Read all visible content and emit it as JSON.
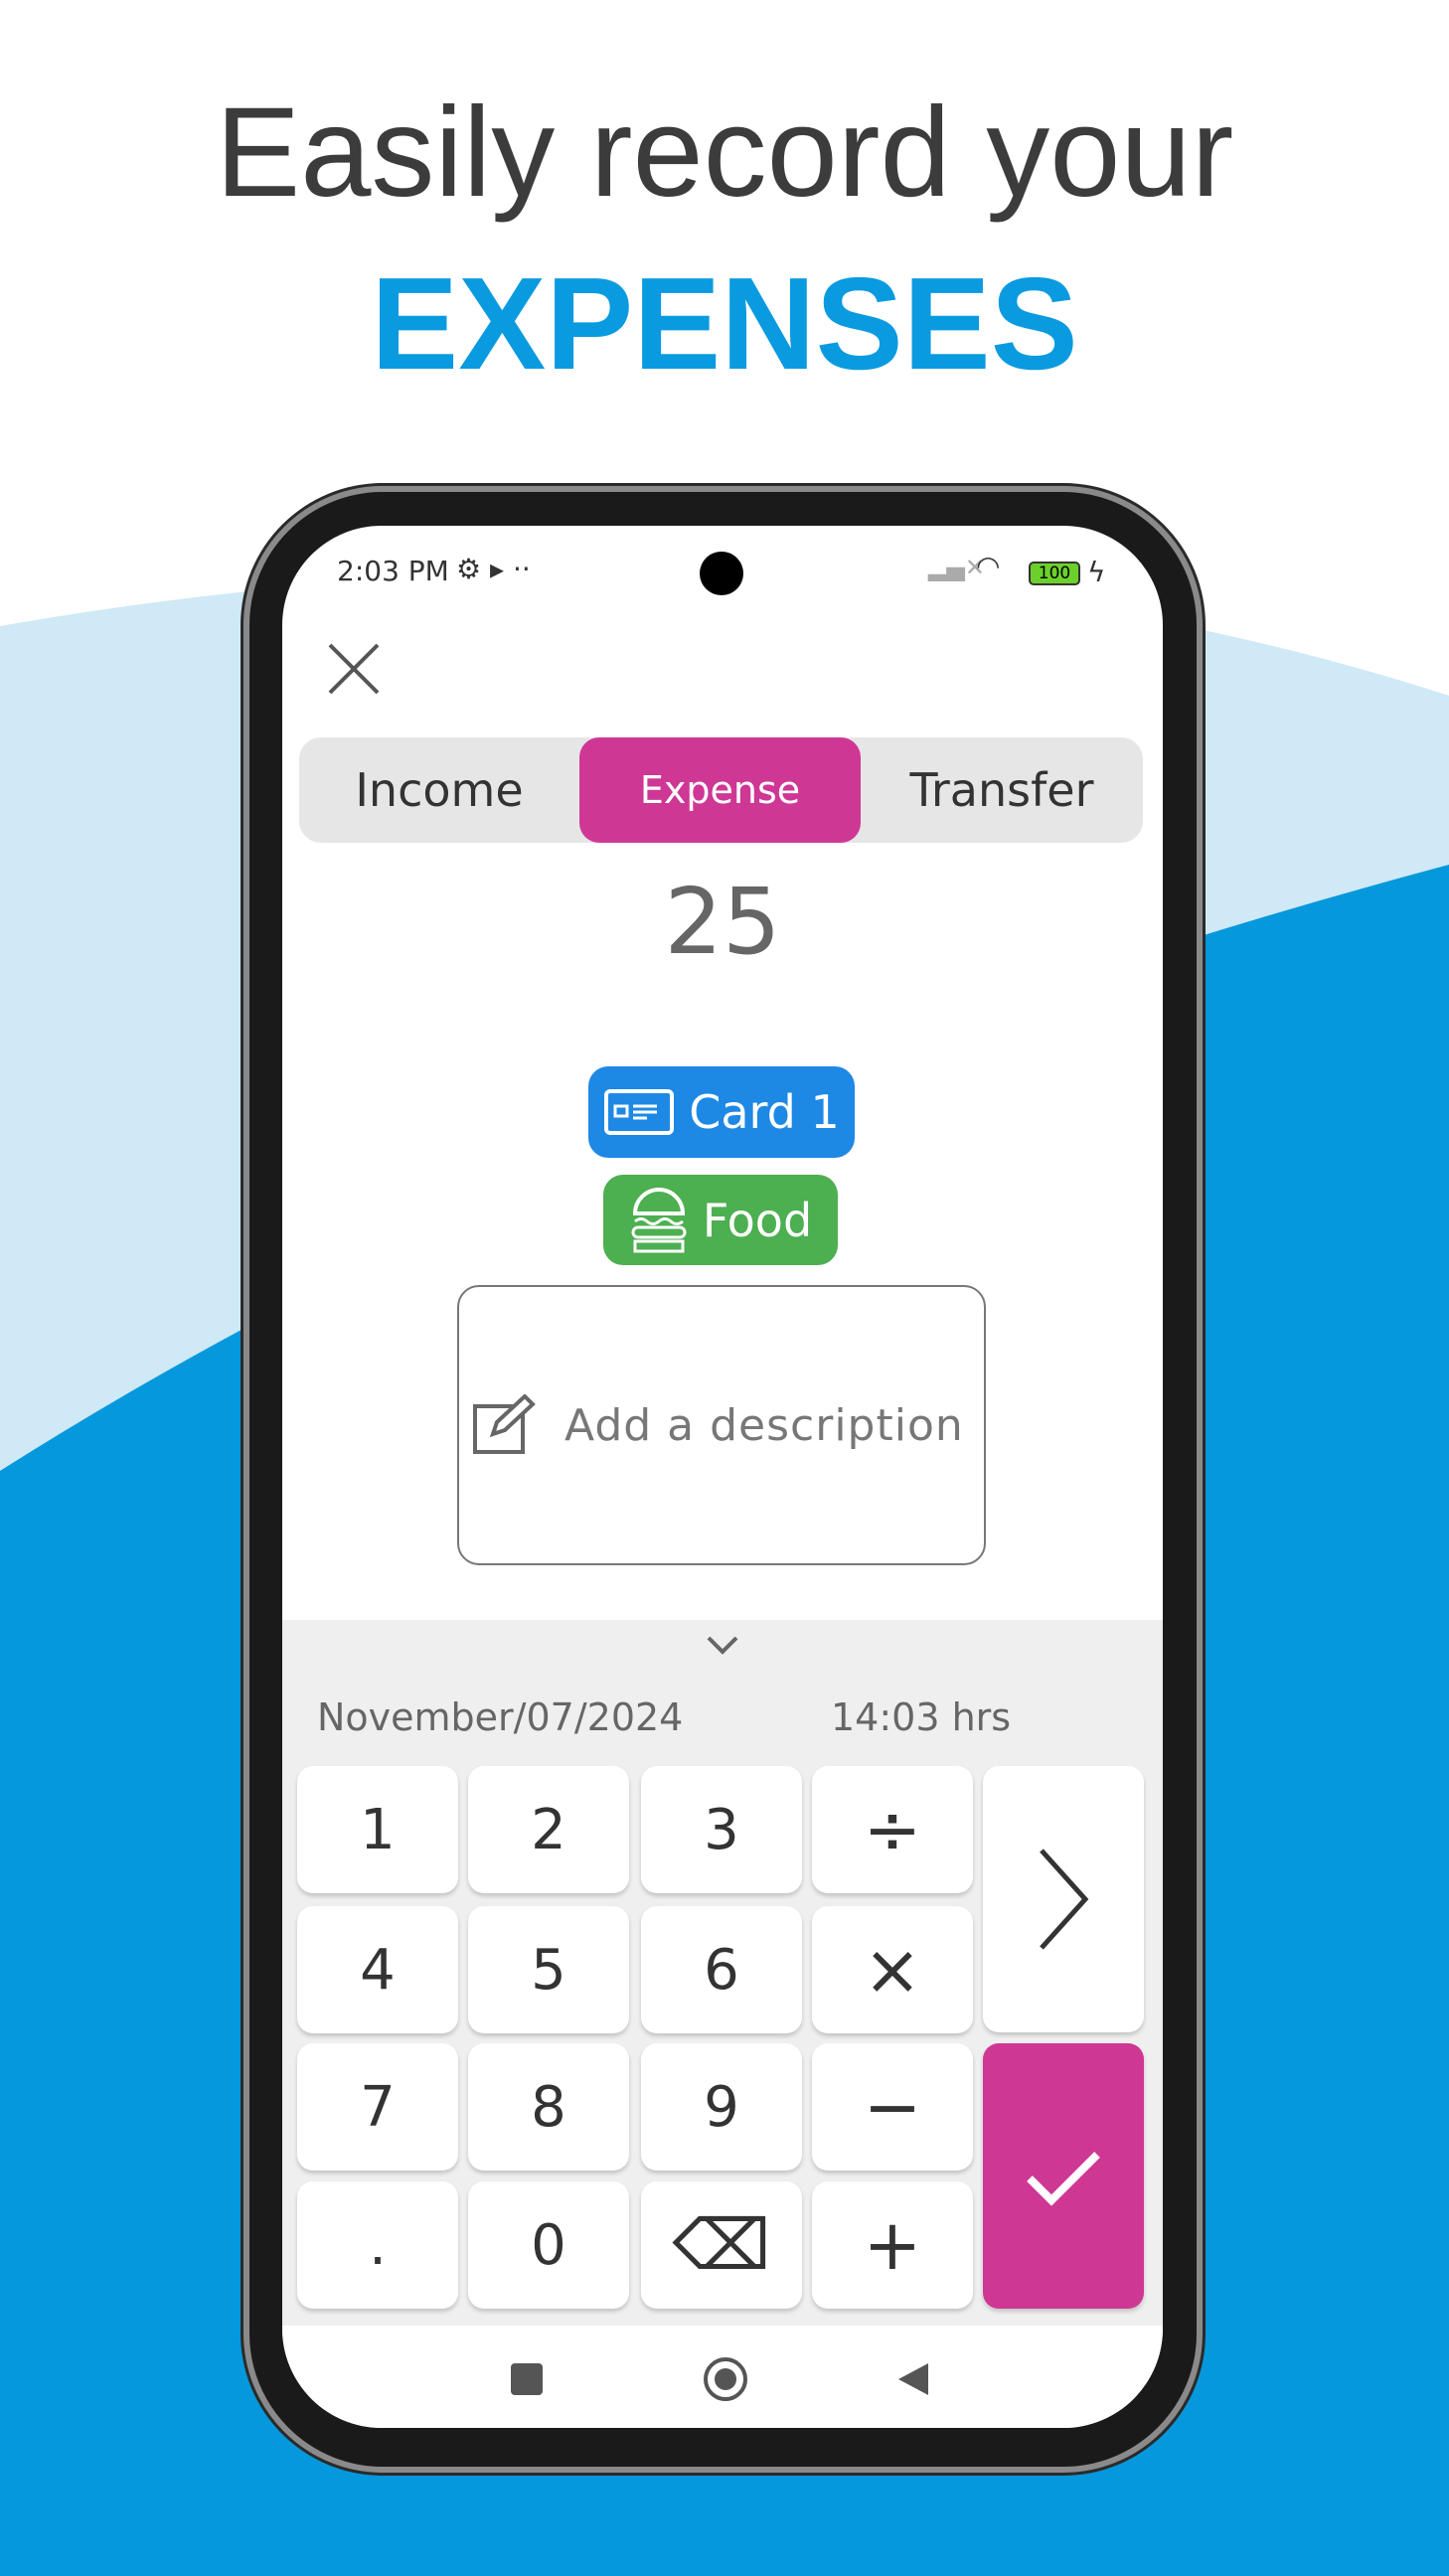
{
  "headline": {
    "line1": "Easily record your",
    "line2": "EXPENSES"
  },
  "colors": {
    "accent_blue": "#0a9ae0",
    "expense_pink": "#cf3795",
    "card_blue": "#1e88e5",
    "food_green": "#4caf50"
  },
  "status_bar": {
    "time": "2:03 PM",
    "battery": "100"
  },
  "tabs": [
    {
      "label": "Income"
    },
    {
      "label": "Expense",
      "selected": true
    },
    {
      "label": "Transfer"
    }
  ],
  "amount": "25",
  "account": {
    "label": "Card 1",
    "icon": "card-icon"
  },
  "category": {
    "label": "Food",
    "icon": "burger-icon"
  },
  "description": {
    "placeholder": "Add a description"
  },
  "date": "November/07/2024",
  "time": "14:03 hrs",
  "keypad": {
    "keys": [
      "1",
      "2",
      "3",
      "÷",
      "4",
      "5",
      "6",
      "×",
      "7",
      "8",
      "9",
      "−",
      ".",
      "0",
      "⌫",
      "+"
    ]
  }
}
